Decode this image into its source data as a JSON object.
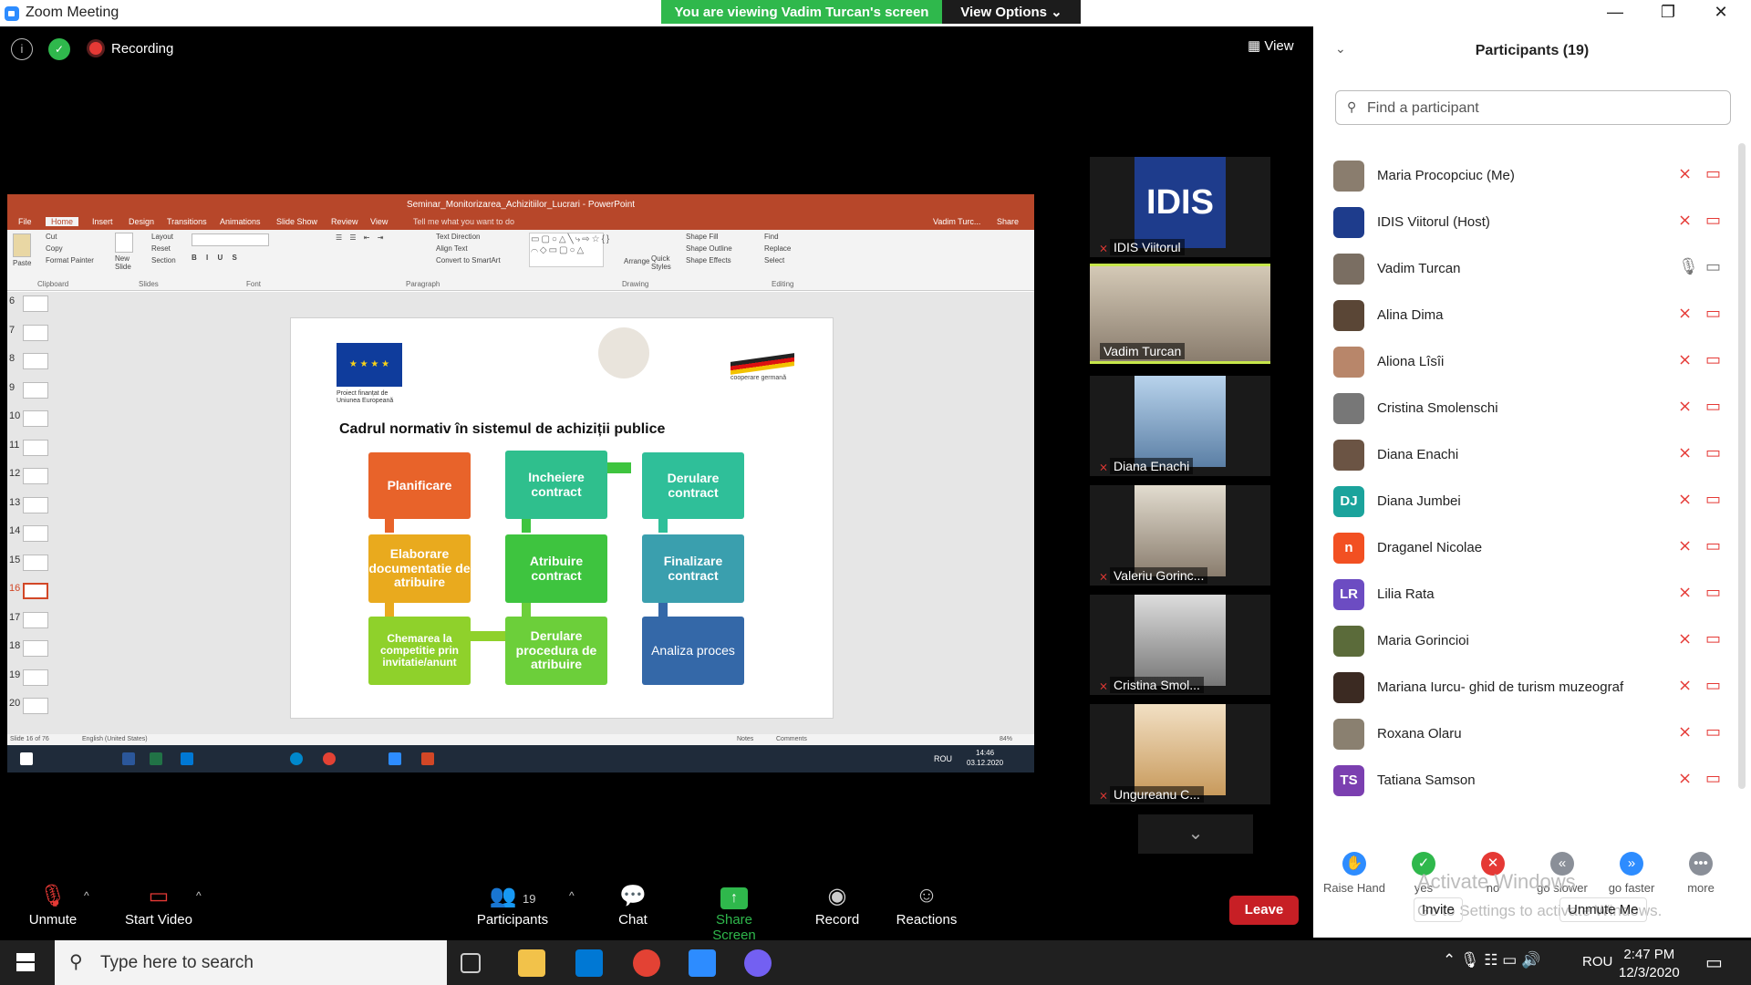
{
  "window": {
    "title": "Zoom Meeting",
    "viewing_banner": "You are viewing Vadim Turcan's screen",
    "view_options": "View Options"
  },
  "meeting": {
    "recording_label": "Recording",
    "view_label": "View"
  },
  "powerpoint": {
    "title": "Seminar_Monitorizarea_Achizitiilor_Lucrari - PowerPoint",
    "tabs": [
      "File",
      "Home",
      "Insert",
      "Design",
      "Transitions",
      "Animations",
      "Slide Show",
      "Review",
      "View",
      "Tell me what you want to do"
    ],
    "user": "Vadim Turc...",
    "share": "Share",
    "ribbon_groups": [
      "Clipboard",
      "Slides",
      "Font",
      "Paragraph",
      "Drawing",
      "Editing"
    ],
    "ribbon_items": [
      "Paste",
      "Cut",
      "Copy",
      "Format Painter",
      "New Slide",
      "Layout",
      "Reset",
      "Section",
      "Text Direction",
      "Align Text",
      "Convert to SmartArt",
      "Arrange",
      "Quick Styles",
      "Shape Fill",
      "Shape Outline",
      "Shape Effects",
      "Find",
      "Replace",
      "Select"
    ],
    "thumb_numbers": [
      "6",
      "7",
      "8",
      "9",
      "10",
      "11",
      "12",
      "13",
      "14",
      "15",
      "16",
      "17",
      "18",
      "19",
      "20"
    ],
    "status_left": "Slide 16 of 76",
    "status_lang": "English (United States)",
    "status_notes": "Notes",
    "status_comments": "Comments",
    "zoom": "84%",
    "os_lang": "ROU",
    "os_time": "14:46",
    "os_date": "03.12.2020"
  },
  "slide": {
    "title": "Cadrul normativ în sistemul de achiziții publice",
    "eu_caption": "Proiect finanțat de Uniunea Europeană",
    "de_caption": "cooperare germană",
    "boxes": [
      {
        "label": "Planificare",
        "color": "#e8632a"
      },
      {
        "label": "Incheiere contract",
        "color": "#2fbf8d"
      },
      {
        "label": "Derulare contract",
        "color": "#2fbf99"
      },
      {
        "label": "Elaborare documentatie de atribuire",
        "color": "#e9aa1e"
      },
      {
        "label": "Atribuire contract",
        "color": "#3ec43f"
      },
      {
        "label": "Finalizare contract",
        "color": "#3a9fae"
      },
      {
        "label": "Chemarea la competitie prin invitatie/anunt",
        "color": "#8fd12b"
      },
      {
        "label": "Derulare procedura de atribuire",
        "color": "#6ccf3a"
      },
      {
        "label": "Analiza proces",
        "color": "#3468a8"
      }
    ]
  },
  "video_tiles": [
    {
      "name": "IDIS Viitorul",
      "logo": "IDIS"
    },
    {
      "name": "Vadim Turcan",
      "active": true
    },
    {
      "name": "Diana Enachi"
    },
    {
      "name": "Valeriu Gorinc..."
    },
    {
      "name": "Cristina Smol..."
    },
    {
      "name": "Ungureanu C..."
    }
  ],
  "toolbar": {
    "unmute": "Unmute",
    "start_video": "Start Video",
    "participants": "Participants",
    "participants_count": "19",
    "chat": "Chat",
    "share_screen": "Share Screen",
    "record": "Record",
    "reactions": "Reactions",
    "leave": "Leave"
  },
  "panel": {
    "title": "Participants (19)",
    "search_placeholder": "Find a participant",
    "participants": [
      {
        "name": "Maria Procopciuc (Me)",
        "initials": "",
        "color": "#8a7d6e"
      },
      {
        "name": "IDIS Viitorul (Host)",
        "initials": "",
        "color": "#1e3c8c"
      },
      {
        "name": "Vadim Turcan",
        "initials": "",
        "color": "#7a6e62"
      },
      {
        "name": "Alina Dima",
        "initials": "",
        "color": "#5a4636"
      },
      {
        "name": "Aliona Lîsîi",
        "initials": "",
        "color": "#b8866a"
      },
      {
        "name": "Cristina Smolenschi",
        "initials": "",
        "color": "#777"
      },
      {
        "name": "Diana Enachi",
        "initials": "",
        "color": "#6b5444"
      },
      {
        "name": "Diana Jumbei",
        "initials": "DJ",
        "color": "#1ba39c"
      },
      {
        "name": "Draganel Nicolae",
        "initials": "n",
        "color": "#f25022"
      },
      {
        "name": "Lilia Rata",
        "initials": "LR",
        "color": "#6c4cc2"
      },
      {
        "name": "Maria Gorincioi",
        "initials": "",
        "color": "#5b6b3a"
      },
      {
        "name": "Mariana Iurcu- ghid de turism muzeograf",
        "initials": "",
        "color": "#3b2a22"
      },
      {
        "name": "Roxana Olaru",
        "initials": "",
        "color": "#8a8070"
      },
      {
        "name": "Tatiana Samson",
        "initials": "TS",
        "color": "#7b3fb0"
      }
    ],
    "reactions": [
      {
        "label": "Raise Hand",
        "color": "#2d8cff",
        "glyph": "✋"
      },
      {
        "label": "yes",
        "color": "#2fb84c",
        "glyph": "✓"
      },
      {
        "label": "no",
        "color": "#e53935",
        "glyph": "✕"
      },
      {
        "label": "go slower",
        "color": "#8a8f98",
        "glyph": "«"
      },
      {
        "label": "go faster",
        "color": "#2d8cff",
        "glyph": "»"
      },
      {
        "label": "more",
        "color": "#8a8f98",
        "glyph": "•••"
      }
    ],
    "watermark_1": "Activate Windows",
    "watermark_2": "Go to Settings to activate Windows.",
    "invite": "Invite",
    "unmute_me": "Unmute Me"
  },
  "taskbar": {
    "search_placeholder": "Type here to search",
    "lang": "ROU",
    "time": "2:47 PM",
    "date": "12/3/2020"
  }
}
